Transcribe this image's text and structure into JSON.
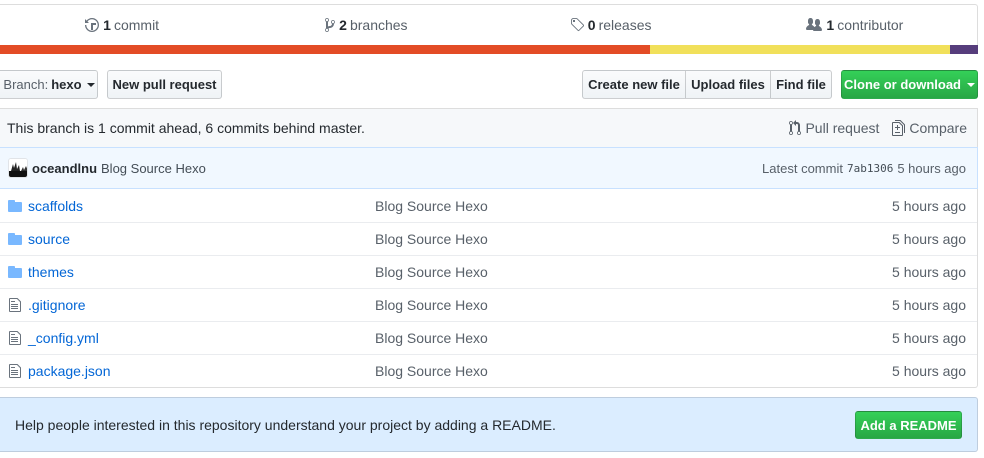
{
  "summary": {
    "commits": {
      "count": "1",
      "label": "commit",
      "icon": "history-icon"
    },
    "branches": {
      "count": "2",
      "label": "branches",
      "icon": "branch-icon"
    },
    "releases": {
      "count": "0",
      "label": "releases",
      "icon": "tag-icon"
    },
    "contributors": {
      "count": "1",
      "label": "contributor",
      "icon": "people-icon"
    }
  },
  "languages": [
    {
      "color": "#e34c26",
      "share": 0.665
    },
    {
      "color": "#f1e05a",
      "share": 0.306
    },
    {
      "color": "#563d7c",
      "share": 0.029
    }
  ],
  "toolbar": {
    "branch_label": "Branch:",
    "branch_value": "hexo",
    "new_pr": "New pull request",
    "create_file": "Create new file",
    "upload_files": "Upload files",
    "find_file": "Find file",
    "clone": "Clone or download"
  },
  "branch_info": {
    "text": "This branch is 1 commit ahead, 6 commits behind master.",
    "pull_request": "Pull request",
    "compare": "Compare"
  },
  "latest_commit": {
    "author": "oceandlnu",
    "message": "Blog Source Hexo",
    "prefix": "Latest commit",
    "sha": "7ab1306",
    "age": "5 hours ago"
  },
  "files": [
    {
      "type": "dir",
      "name": "scaffolds",
      "message": "Blog Source Hexo",
      "age": "5 hours ago"
    },
    {
      "type": "dir",
      "name": "source",
      "message": "Blog Source Hexo",
      "age": "5 hours ago"
    },
    {
      "type": "dir",
      "name": "themes",
      "message": "Blog Source Hexo",
      "age": "5 hours ago"
    },
    {
      "type": "file",
      "name": ".gitignore",
      "message": "Blog Source Hexo",
      "age": "5 hours ago"
    },
    {
      "type": "file",
      "name": "_config.yml",
      "message": "Blog Source Hexo",
      "age": "5 hours ago"
    },
    {
      "type": "file",
      "name": "package.json",
      "message": "Blog Source Hexo",
      "age": "5 hours ago"
    }
  ],
  "readme": {
    "text": "Help people interested in this repository understand your project by adding a README.",
    "button": "Add a README"
  },
  "colors": {
    "link": "#0366d6",
    "primary_button": "#28a745",
    "commit_bg": "#f1f8ff",
    "readme_bg": "#dbedff"
  }
}
